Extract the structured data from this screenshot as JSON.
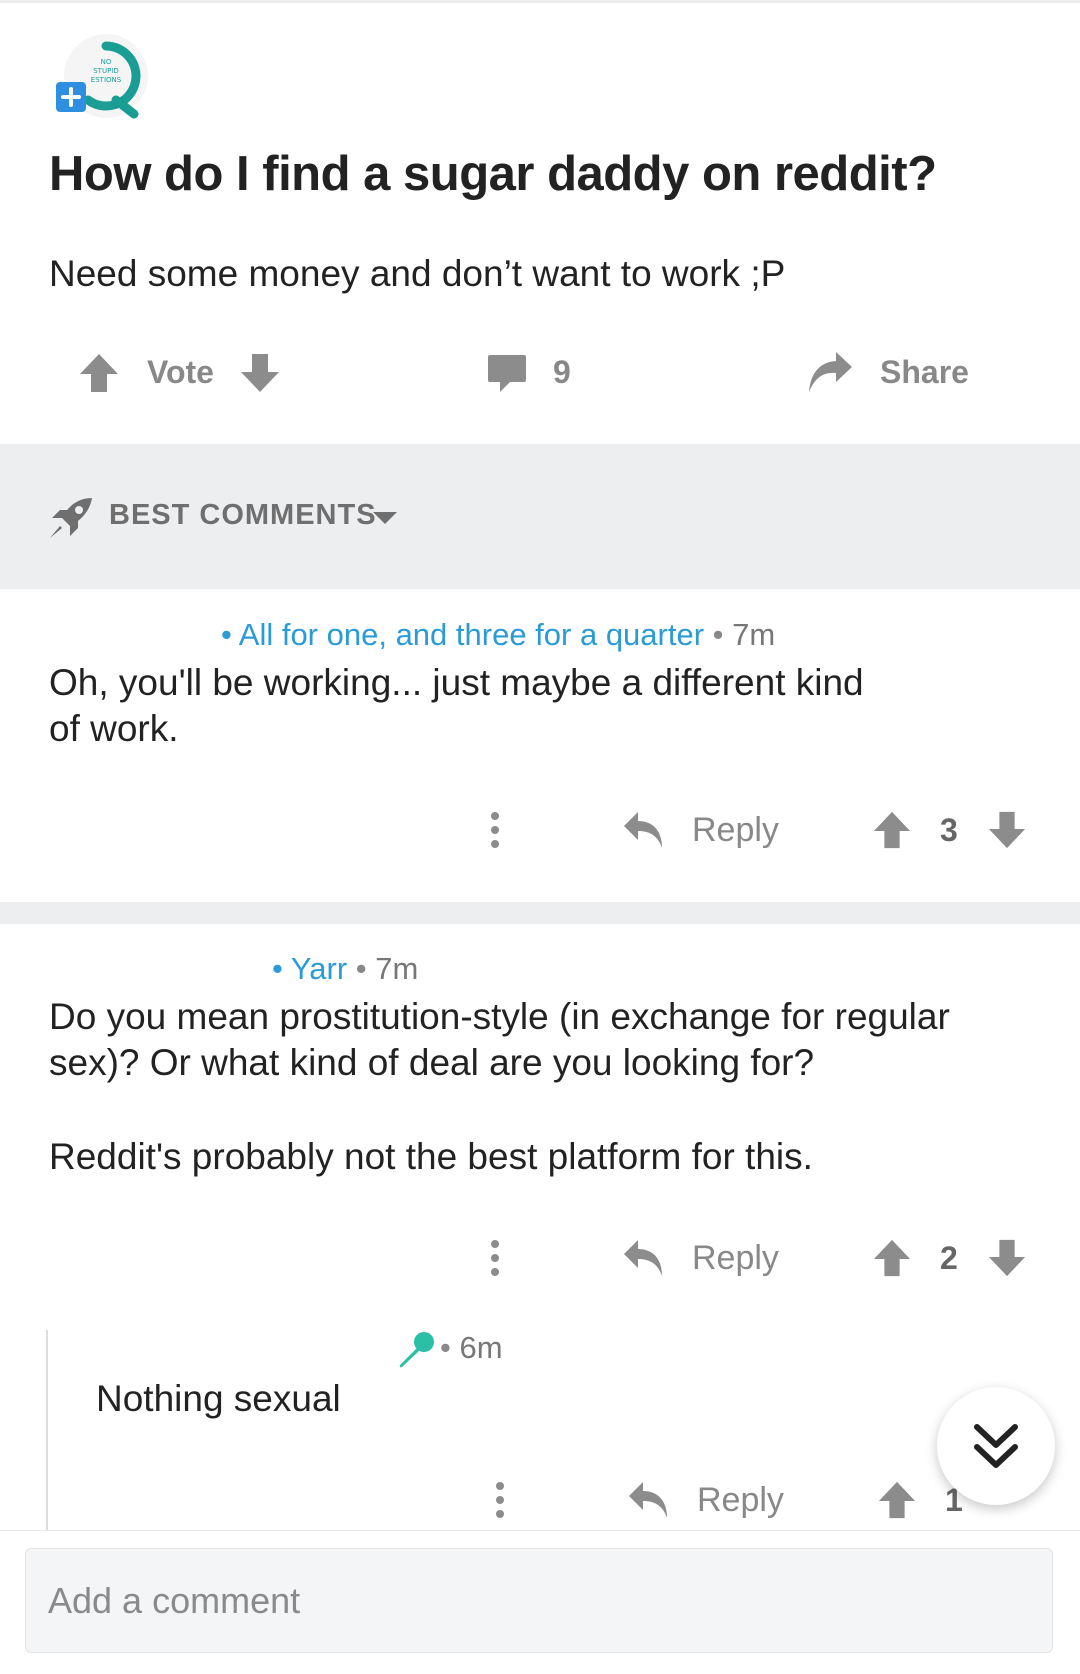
{
  "post": {
    "title": "How do I find a sugar daddy on reddit?",
    "body": "Need some money and don’t want to work ;P",
    "vote_label": "Vote",
    "comment_count": "9",
    "share_label": "Share"
  },
  "subreddit_logo": {
    "text_lines": [
      "NO",
      "STUPID",
      "ESTIONS"
    ],
    "colors": {
      "ring": "#1a9e94",
      "plus_bg": "#2e8fe0"
    }
  },
  "sort": {
    "label": "BEST COMMENTS",
    "icon": "rocket-icon"
  },
  "comments": [
    {
      "author": "All for one, and three for a quarter",
      "time": "7m",
      "text": "Oh, you'll be working... just maybe a different kind of work.",
      "reply_label": "Reply",
      "score": "3"
    },
    {
      "author": "Yarr",
      "time": "7m",
      "text_lines": [
        "Do you mean prostitution-style (in exchange for regular sex)? Or what kind of deal are you looking for?",
        "Reddit's probably not the best platform for this."
      ],
      "reply_label": "Reply",
      "score": "2",
      "replies": [
        {
          "author_icon": "microphone-icon",
          "time": "6m",
          "text": "Nothing sexual",
          "reply_label": "Reply",
          "score": "1"
        }
      ]
    }
  ],
  "composer": {
    "placeholder": "Add a comment"
  },
  "colors": {
    "accent": "#2a9bd6",
    "icon_gray": "#8c8c8c",
    "band": "#eceef0",
    "mic": "#2bbfa8"
  }
}
